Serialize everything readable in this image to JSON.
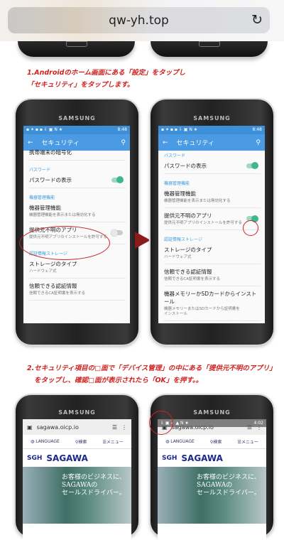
{
  "browser": {
    "url": "qw-yh.top",
    "reload_icon": "reload-icon"
  },
  "step1": {
    "line1": "1.Androidのホーム画面にある「設定」をタップし",
    "line2": "「セキュリティ」をタップします。"
  },
  "step2": {
    "line1": "2.セキュリティ項目の□面で「デバイス管理」の中にある「提供元不明のアプリ」",
    "line2": "をタップし、確認□面が表示されたら「OK」を押す。。"
  },
  "phone": {
    "brand": "SAMSUNG",
    "time": "8:48",
    "battery": "100",
    "title": "セキュリティ"
  },
  "settings_left": [
    {
      "type": "item",
      "title": "携帯端末の暗号化"
    },
    {
      "type": "header",
      "title": "パスワード"
    },
    {
      "type": "item",
      "title": "パスワードの表示",
      "switch": "on"
    },
    {
      "type": "header",
      "title": "機器管理機能"
    },
    {
      "type": "item",
      "title": "機器管理機能",
      "sub": "機器管理機能を表示または無効化する"
    },
    {
      "type": "item",
      "title": "提供元不明のアプリ",
      "sub": "提供元不明アプリのインストールを許可する",
      "switch": "off"
    },
    {
      "type": "header",
      "title": "認証情報ストレージ"
    },
    {
      "type": "item",
      "title": "ストレージのタイプ",
      "sub": "ハードウェア式"
    },
    {
      "type": "item",
      "title": "信頼できる認証情報",
      "sub": "信頼できるCA証明書を表示する"
    }
  ],
  "settings_right": [
    {
      "type": "header",
      "title": "パスワード"
    },
    {
      "type": "item",
      "title": "パスワードの表示",
      "switch": "on"
    },
    {
      "type": "header",
      "title": "機器管理機能"
    },
    {
      "type": "item",
      "title": "機器管理機能",
      "sub": "機器管理機能を表示または無効化する"
    },
    {
      "type": "item",
      "title": "提供元不明のアプリ",
      "sub": "提供元不明アプリのインストールを許可する",
      "switch": "on"
    },
    {
      "type": "header",
      "title": "認証情報ストレージ"
    },
    {
      "type": "item",
      "title": "ストレージのタイプ",
      "sub": "ハードウェア式"
    },
    {
      "type": "item",
      "title": "信頼できる認証情報",
      "sub": "信頼できるCA証明書を表示する"
    },
    {
      "type": "item",
      "title": "機器メモリーかSDカードからインストール",
      "sub": "機器メモリーまたはSDカードから証明書をインストール"
    }
  ],
  "web": {
    "url": "sagawa.oicp.io",
    "language": "LANGUAGE",
    "search": "検索",
    "menu": "メニュー",
    "logo_mark": "SGH",
    "logo": "SAGAWA",
    "banner_line1": "お客様のビジネスに、",
    "banner_line2": "SAGAWAの",
    "banner_line3": "セールスドライバー。",
    "time2": "4:02"
  }
}
